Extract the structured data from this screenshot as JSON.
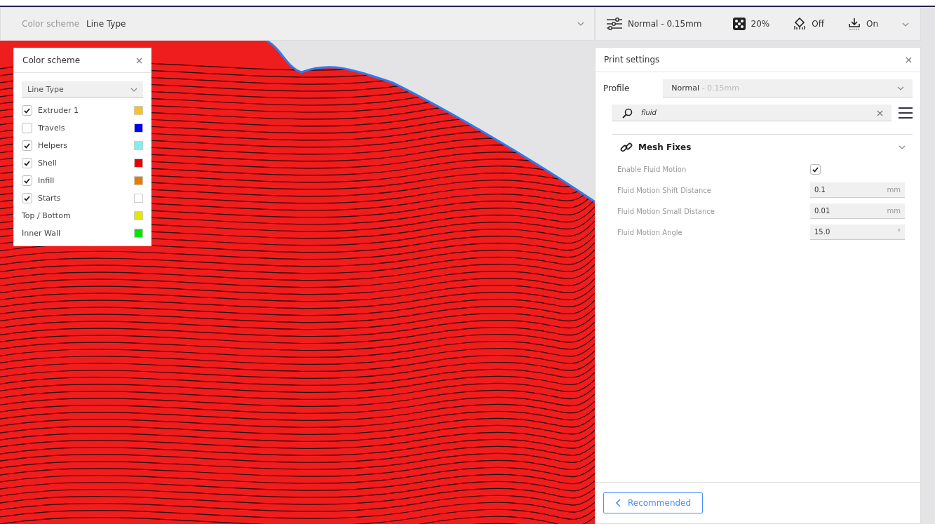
{
  "view_bar": {
    "label": "Color scheme",
    "value": "Line Type"
  },
  "print_bar": {
    "profile": "Normal - 0.15mm",
    "infill": "20%",
    "support": "Off",
    "adhesion": "On"
  },
  "color_panel": {
    "title": "Color scheme",
    "dropdown": "Line Type",
    "items": [
      {
        "kind": "checkbox",
        "label": "Extruder 1",
        "checked": true,
        "color": "#fbc21e"
      },
      {
        "kind": "checkbox",
        "label": "Travels",
        "checked": false,
        "color": "#0000ff"
      },
      {
        "kind": "checkbox",
        "label": "Helpers",
        "checked": true,
        "color": "#7ff0ef"
      },
      {
        "kind": "checkbox",
        "label": "Shell",
        "checked": true,
        "color": "#e60000"
      },
      {
        "kind": "checkbox",
        "label": "Infill",
        "checked": true,
        "color": "#e77a00"
      },
      {
        "kind": "checkbox",
        "label": "Starts",
        "checked": true,
        "color": "#ffffff"
      },
      {
        "kind": "plain",
        "label": "Top / Bottom",
        "color": "#e5e500"
      },
      {
        "kind": "plain",
        "label": "Inner Wall",
        "color": "#00e600"
      }
    ]
  },
  "print_settings": {
    "title": "Print settings",
    "profile_label": "Profile",
    "profile_name": "Normal",
    "profile_detail": "- 0.15mm",
    "search": {
      "value": "fluid"
    },
    "category": {
      "title": "Mesh Fixes",
      "expanded": true
    },
    "settings": [
      {
        "kind": "checkbox",
        "label": "Enable Fluid Motion",
        "checked": true
      },
      {
        "kind": "number",
        "label": "Fluid Motion Shift Distance",
        "value": "0.1",
        "unit": "mm"
      },
      {
        "kind": "number",
        "label": "Fluid Motion Small Distance",
        "value": "0.01",
        "unit": "mm"
      },
      {
        "kind": "number",
        "label": "Fluid Motion Angle",
        "value": "15.0",
        "unit": "°"
      }
    ],
    "footer_button": "Recommended"
  }
}
